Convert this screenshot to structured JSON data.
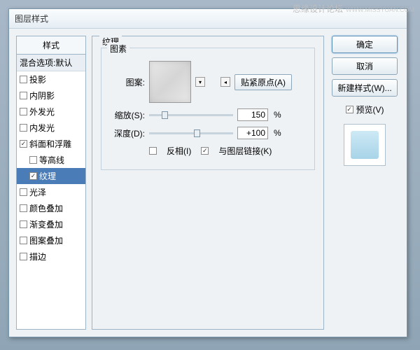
{
  "watermark": {
    "main": "思缘设计论坛",
    "sub": "WWW.MISSYUAN.COM"
  },
  "dialog": {
    "title": "图层样式"
  },
  "styles": {
    "header": "样式",
    "blend": "混合选项:默认",
    "items": [
      {
        "label": "投影",
        "checked": false
      },
      {
        "label": "内阴影",
        "checked": false
      },
      {
        "label": "外发光",
        "checked": false
      },
      {
        "label": "内发光",
        "checked": false
      },
      {
        "label": "斜面和浮雕",
        "checked": true
      },
      {
        "label": "等高线",
        "checked": false,
        "indent": true
      },
      {
        "label": "纹理",
        "checked": true,
        "indent": true,
        "selected": true
      },
      {
        "label": "光泽",
        "checked": false
      },
      {
        "label": "颜色叠加",
        "checked": false
      },
      {
        "label": "渐变叠加",
        "checked": false
      },
      {
        "label": "图案叠加",
        "checked": false
      },
      {
        "label": "描边",
        "checked": false
      }
    ]
  },
  "texture": {
    "group_label": "纹理",
    "sub_label": "图素",
    "pattern_label": "图案:",
    "snap_button": "贴紧原点(A)",
    "scale_label": "缩放(S):",
    "scale_value": "150",
    "depth_label": "深度(D):",
    "depth_value": "+100",
    "percent": "%",
    "invert_label": "反相(I)",
    "invert_checked": false,
    "link_label": "与图层链接(K)",
    "link_checked": true
  },
  "buttons": {
    "ok": "确定",
    "cancel": "取消",
    "new_style": "新建样式(W)...",
    "preview": "预览(V)"
  }
}
